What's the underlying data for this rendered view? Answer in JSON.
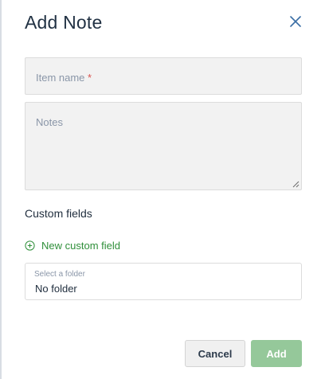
{
  "dialog": {
    "title": "Add Note",
    "close_icon": "close-icon"
  },
  "form": {
    "item_name": {
      "placeholder": "Item name",
      "required_marker": "*",
      "value": ""
    },
    "notes": {
      "placeholder": "Notes",
      "value": ""
    },
    "custom_fields": {
      "heading": "Custom fields",
      "new_field_label": "New custom field",
      "new_field_icon": "plus-circle-icon"
    },
    "folder": {
      "caption": "Select a folder",
      "value": "No folder"
    }
  },
  "actions": {
    "cancel_label": "Cancel",
    "add_label": "Add"
  },
  "colors": {
    "accent_green": "#2f8f3a",
    "add_button_disabled": "#95c89a",
    "required": "#d9534f",
    "close_icon": "#3a6ea5"
  }
}
